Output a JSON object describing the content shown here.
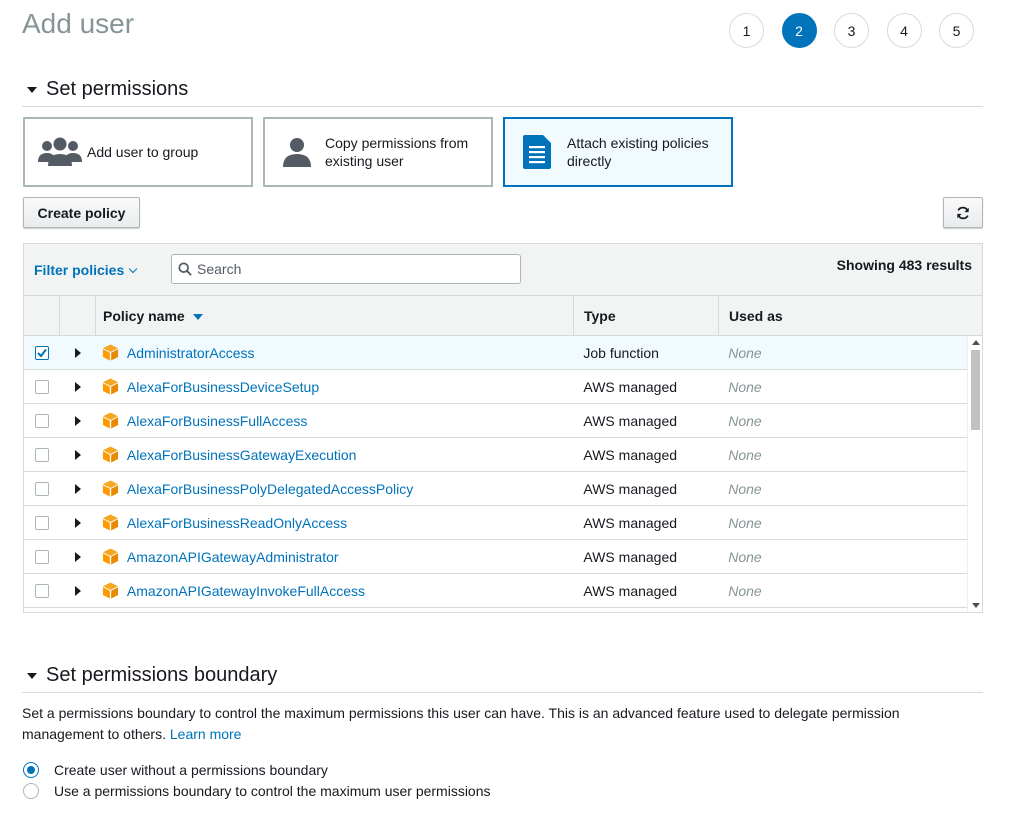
{
  "page": {
    "title": "Add user"
  },
  "steps": [
    "1",
    "2",
    "3",
    "4",
    "5"
  ],
  "permissions_section": {
    "title": "Set permissions"
  },
  "options": {
    "add_to_group": "Add user to group",
    "copy_permissions": "Copy permissions from existing user",
    "attach_policies": "Attach existing policies directly"
  },
  "toolbar": {
    "create_policy": "Create policy"
  },
  "table": {
    "filter_label": "Filter policies",
    "search_placeholder": "Search",
    "results": "Showing 483 results",
    "columns": {
      "name": "Policy name",
      "type": "Type",
      "used_as": "Used as"
    },
    "rows": [
      {
        "name": "AdministratorAccess",
        "type": "Job function",
        "used_as": "None",
        "checked": true
      },
      {
        "name": "AlexaForBusinessDeviceSetup",
        "type": "AWS managed",
        "used_as": "None",
        "checked": false
      },
      {
        "name": "AlexaForBusinessFullAccess",
        "type": "AWS managed",
        "used_as": "None",
        "checked": false
      },
      {
        "name": "AlexaForBusinessGatewayExecution",
        "type": "AWS managed",
        "used_as": "None",
        "checked": false
      },
      {
        "name": "AlexaForBusinessPolyDelegatedAccessPolicy",
        "type": "AWS managed",
        "used_as": "None",
        "checked": false
      },
      {
        "name": "AlexaForBusinessReadOnlyAccess",
        "type": "AWS managed",
        "used_as": "None",
        "checked": false
      },
      {
        "name": "AmazonAPIGatewayAdministrator",
        "type": "AWS managed",
        "used_as": "None",
        "checked": false
      },
      {
        "name": "AmazonAPIGatewayInvokeFullAccess",
        "type": "AWS managed",
        "used_as": "None",
        "checked": false
      }
    ]
  },
  "boundary_section": {
    "title": "Set permissions boundary",
    "description": "Set a permissions boundary to control the maximum permissions this user can have. This is an advanced feature used to delegate permission management to others.",
    "learn_more": "Learn more",
    "option_none": "Create user without a permissions boundary",
    "option_use": "Use a permissions boundary to control the maximum user permissions"
  },
  "colors": {
    "accent": "#0073bb",
    "selected_bg": "#f1faff",
    "policy_icon": "#f90"
  }
}
